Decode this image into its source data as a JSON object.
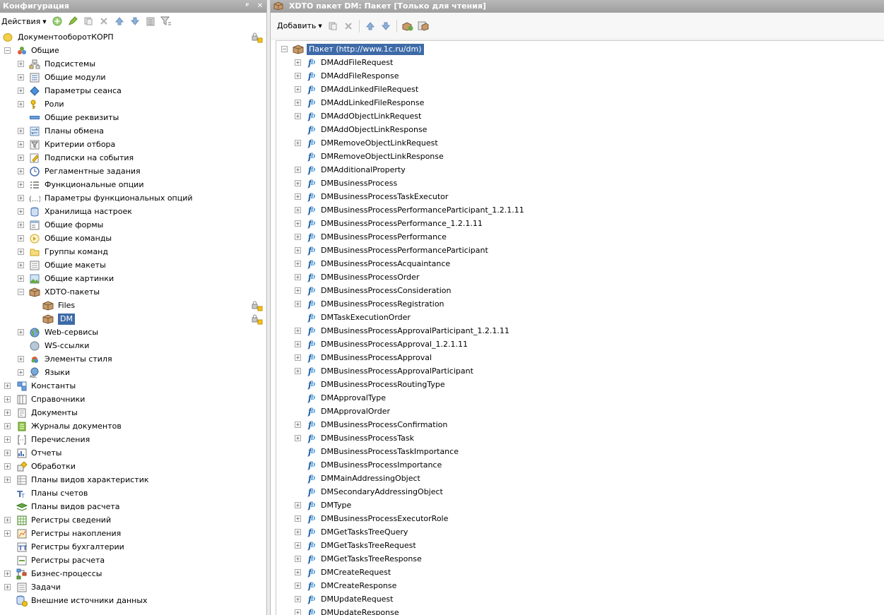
{
  "left_panel": {
    "title": "Конфигурация",
    "pin_glyph": "ᵖ",
    "close_glyph": "✕",
    "actions_label": "Действия",
    "root": {
      "label": "ДокументооборотКОРП"
    },
    "tree": [
      {
        "label": "Общие",
        "level": 1,
        "expander": "minus",
        "icon": "common-icon"
      },
      {
        "label": "Подсистемы",
        "level": 2,
        "expander": "plus",
        "icon": "subsystems-icon"
      },
      {
        "label": "Общие модули",
        "level": 2,
        "expander": "plus",
        "icon": "common-modules-icon"
      },
      {
        "label": "Параметры сеанса",
        "level": 2,
        "expander": "plus",
        "icon": "session-params-icon"
      },
      {
        "label": "Роли",
        "level": 2,
        "expander": "plus",
        "icon": "key-icon"
      },
      {
        "label": "Общие реквизиты",
        "level": 2,
        "expander": "none",
        "icon": "attribute-icon"
      },
      {
        "label": "Планы обмена",
        "level": 2,
        "expander": "plus",
        "icon": "exchange-plans-icon"
      },
      {
        "label": "Критерии отбора",
        "level": 2,
        "expander": "plus",
        "icon": "filter-criteria-icon"
      },
      {
        "label": "Подписки на события",
        "level": 2,
        "expander": "plus",
        "icon": "event-subscriptions-icon"
      },
      {
        "label": "Регламентные задания",
        "level": 2,
        "expander": "plus",
        "icon": "clock-icon"
      },
      {
        "label": "Функциональные опции",
        "level": 2,
        "expander": "plus",
        "icon": "functional-options-icon"
      },
      {
        "label": "Параметры функциональных опций",
        "level": 2,
        "expander": "plus",
        "icon": "functional-params-icon"
      },
      {
        "label": "Хранилища настроек",
        "level": 2,
        "expander": "plus",
        "icon": "settings-storage-icon"
      },
      {
        "label": "Общие формы",
        "level": 2,
        "expander": "plus",
        "icon": "form-icon"
      },
      {
        "label": "Общие команды",
        "level": 2,
        "expander": "plus",
        "icon": "command-icon"
      },
      {
        "label": "Группы команд",
        "level": 2,
        "expander": "plus",
        "icon": "folder-icon"
      },
      {
        "label": "Общие макеты",
        "level": 2,
        "expander": "plus",
        "icon": "template-icon"
      },
      {
        "label": "Общие картинки",
        "level": 2,
        "expander": "plus",
        "icon": "picture-icon"
      },
      {
        "label": "XDTO-пакеты",
        "level": 2,
        "expander": "minus",
        "icon": "package-icon"
      },
      {
        "label": "Files",
        "level": 3,
        "expander": "none",
        "icon": "package-icon",
        "lock": true
      },
      {
        "label": "DM",
        "level": 3,
        "expander": "none",
        "icon": "package-icon",
        "lock": true,
        "selected": true
      },
      {
        "label": "Web-сервисы",
        "level": 2,
        "expander": "plus",
        "icon": "web-service-icon"
      },
      {
        "label": "WS-ссылки",
        "level": 2,
        "expander": "none",
        "icon": "ws-link-icon"
      },
      {
        "label": "Элементы стиля",
        "level": 2,
        "expander": "plus",
        "icon": "style-icon"
      },
      {
        "label": "Языки",
        "level": 2,
        "expander": "plus",
        "icon": "languages-icon"
      },
      {
        "label": "Константы",
        "level": 1,
        "expander": "plus",
        "icon": "constants-icon"
      },
      {
        "label": "Справочники",
        "level": 1,
        "expander": "plus",
        "icon": "catalogs-icon"
      },
      {
        "label": "Документы",
        "level": 1,
        "expander": "plus",
        "icon": "documents-icon"
      },
      {
        "label": "Журналы документов",
        "level": 1,
        "expander": "plus",
        "icon": "journals-icon"
      },
      {
        "label": "Перечисления",
        "level": 1,
        "expander": "plus",
        "icon": "enums-icon"
      },
      {
        "label": "Отчеты",
        "level": 1,
        "expander": "plus",
        "icon": "reports-icon"
      },
      {
        "label": "Обработки",
        "level": 1,
        "expander": "plus",
        "icon": "data-processors-icon"
      },
      {
        "label": "Планы видов характеристик",
        "level": 1,
        "expander": "plus",
        "icon": "chart-of-characteristics-icon"
      },
      {
        "label": "Планы счетов",
        "level": 1,
        "expander": "none",
        "icon": "chart-of-accounts-icon"
      },
      {
        "label": "Планы видов расчета",
        "level": 1,
        "expander": "none",
        "icon": "calculation-types-icon"
      },
      {
        "label": "Регистры сведений",
        "level": 1,
        "expander": "plus",
        "icon": "info-registers-icon"
      },
      {
        "label": "Регистры накопления",
        "level": 1,
        "expander": "plus",
        "icon": "accumulation-registers-icon"
      },
      {
        "label": "Регистры бухгалтерии",
        "level": 1,
        "expander": "none",
        "icon": "accounting-registers-icon"
      },
      {
        "label": "Регистры расчета",
        "level": 1,
        "expander": "none",
        "icon": "calculation-registers-icon"
      },
      {
        "label": "Бизнес-процессы",
        "level": 1,
        "expander": "plus",
        "icon": "business-processes-icon"
      },
      {
        "label": "Задачи",
        "level": 1,
        "expander": "plus",
        "icon": "tasks-icon"
      },
      {
        "label": "Внешние источники данных",
        "level": 1,
        "expander": "none",
        "icon": "external-sources-icon"
      }
    ]
  },
  "right_panel": {
    "title": "XDTO пакет DM: Пакет [Только для чтения]",
    "add_label": "Добавить",
    "package_root": "Пакет (http://www.1c.ru/dm)",
    "types": [
      {
        "label": "DMAddFileRequest",
        "expander": "plus"
      },
      {
        "label": "DMAddFileResponse",
        "expander": "plus"
      },
      {
        "label": "DMAddLinkedFileRequest",
        "expander": "plus"
      },
      {
        "label": "DMAddLinkedFileResponse",
        "expander": "plus"
      },
      {
        "label": "DMAddObjectLinkRequest",
        "expander": "plus"
      },
      {
        "label": "DMAddObjectLinkResponse",
        "expander": "none"
      },
      {
        "label": "DMRemoveObjectLinkRequest",
        "expander": "plus"
      },
      {
        "label": "DMRemoveObjectLinkResponse",
        "expander": "none"
      },
      {
        "label": "DMAdditionalProperty",
        "expander": "plus"
      },
      {
        "label": "DMBusinessProcess",
        "expander": "plus"
      },
      {
        "label": "DMBusinessProcessTaskExecutor",
        "expander": "plus"
      },
      {
        "label": "DMBusinessProcessPerformanceParticipant_1.2.1.11",
        "expander": "plus"
      },
      {
        "label": "DMBusinessProcessPerformance_1.2.1.11",
        "expander": "plus"
      },
      {
        "label": "DMBusinessProcessPerformance",
        "expander": "plus"
      },
      {
        "label": "DMBusinessProcessPerformanceParticipant",
        "expander": "plus"
      },
      {
        "label": "DMBusinessProcessAcquaintance",
        "expander": "plus"
      },
      {
        "label": "DMBusinessProcessOrder",
        "expander": "plus"
      },
      {
        "label": "DMBusinessProcessConsideration",
        "expander": "plus"
      },
      {
        "label": "DMBusinessProcessRegistration",
        "expander": "plus"
      },
      {
        "label": "DMTaskExecutionOrder",
        "expander": "none"
      },
      {
        "label": "DMBusinessProcessApprovalParticipant_1.2.1.11",
        "expander": "plus"
      },
      {
        "label": "DMBusinessProcessApproval_1.2.1.11",
        "expander": "plus"
      },
      {
        "label": "DMBusinessProcessApproval",
        "expander": "plus"
      },
      {
        "label": "DMBusinessProcessApprovalParticipant",
        "expander": "plus"
      },
      {
        "label": "DMBusinessProcessRoutingType",
        "expander": "none"
      },
      {
        "label": "DMApprovalType",
        "expander": "none"
      },
      {
        "label": "DMApprovalOrder",
        "expander": "none"
      },
      {
        "label": "DMBusinessProcessConfirmation",
        "expander": "plus"
      },
      {
        "label": "DMBusinessProcessTask",
        "expander": "plus"
      },
      {
        "label": "DMBusinessProcessTaskImportance",
        "expander": "none"
      },
      {
        "label": "DMBusinessProcessImportance",
        "expander": "none"
      },
      {
        "label": "DMMainAddressingObject",
        "expander": "none"
      },
      {
        "label": "DMSecondaryAddressingObject",
        "expander": "none"
      },
      {
        "label": "DMType",
        "expander": "plus"
      },
      {
        "label": "DMBusinessProcessExecutorRole",
        "expander": "plus"
      },
      {
        "label": "DMGetTasksTreeQuery",
        "expander": "plus"
      },
      {
        "label": "DMGetTasksTreeRequest",
        "expander": "plus"
      },
      {
        "label": "DMGetTasksTreeResponse",
        "expander": "plus"
      },
      {
        "label": "DMCreateRequest",
        "expander": "plus"
      },
      {
        "label": "DMCreateResponse",
        "expander": "plus"
      },
      {
        "label": "DMUpdateRequest",
        "expander": "plus"
      },
      {
        "label": "DMUpdateResponse",
        "expander": "plus"
      }
    ]
  },
  "colors": {
    "selection": "#3e6ba8",
    "titlebar": "#a9a9a9",
    "type_icon": "#1f5fa8"
  }
}
